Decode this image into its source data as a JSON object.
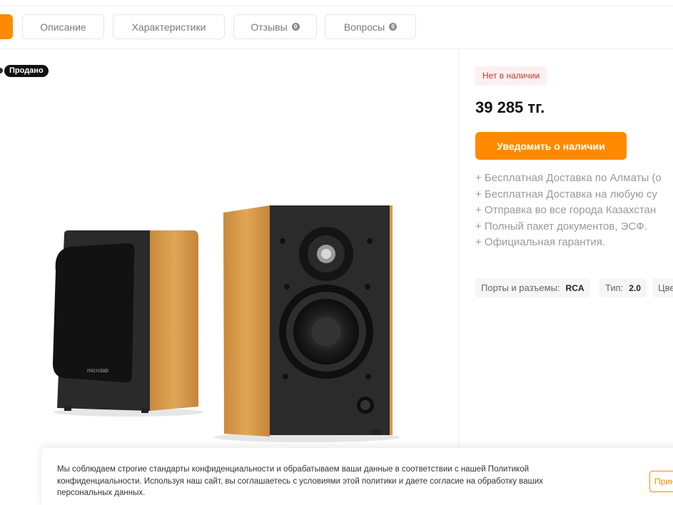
{
  "tabs": [
    {
      "label": "Описание"
    },
    {
      "label": "Характеристики"
    },
    {
      "label": "Отзывы",
      "count": "0"
    },
    {
      "label": "Вопросы",
      "count": "0"
    }
  ],
  "product": {
    "sold_badge": "Продано",
    "brand_on_speaker": "microlab",
    "stock_status": "Нет в наличии",
    "price": "39 285 тг.",
    "notify_button": "Уведомить о наличии",
    "benefits": [
      "+ Бесплатная Доставка по Алматы (о",
      "+ Бесплатная Доставка на любую су",
      "+ Отправка во все города Казахстан",
      "+ Полный пакет документов, ЭСФ.",
      "+ Официальная гарантия."
    ],
    "specs": [
      {
        "label": "Порты и разъемы:",
        "value": "RCA"
      },
      {
        "label": "Тип:",
        "value": "2.0"
      },
      {
        "label": "Цве",
        "value": ""
      }
    ]
  },
  "cookie": {
    "text": "Мы соблюдаем строгие стандарты конфиденциальности и обрабатываем ваши данные в соответствии с нашей Политикой конфиденциальности. Используя наш сайт, вы соглашаетесь с условиями этой политики и даете согласие на обработку ваших персональных данных.",
    "accept_button": "Прин"
  },
  "colors": {
    "accent": "#ff8a00",
    "stock": "#c0392b"
  }
}
